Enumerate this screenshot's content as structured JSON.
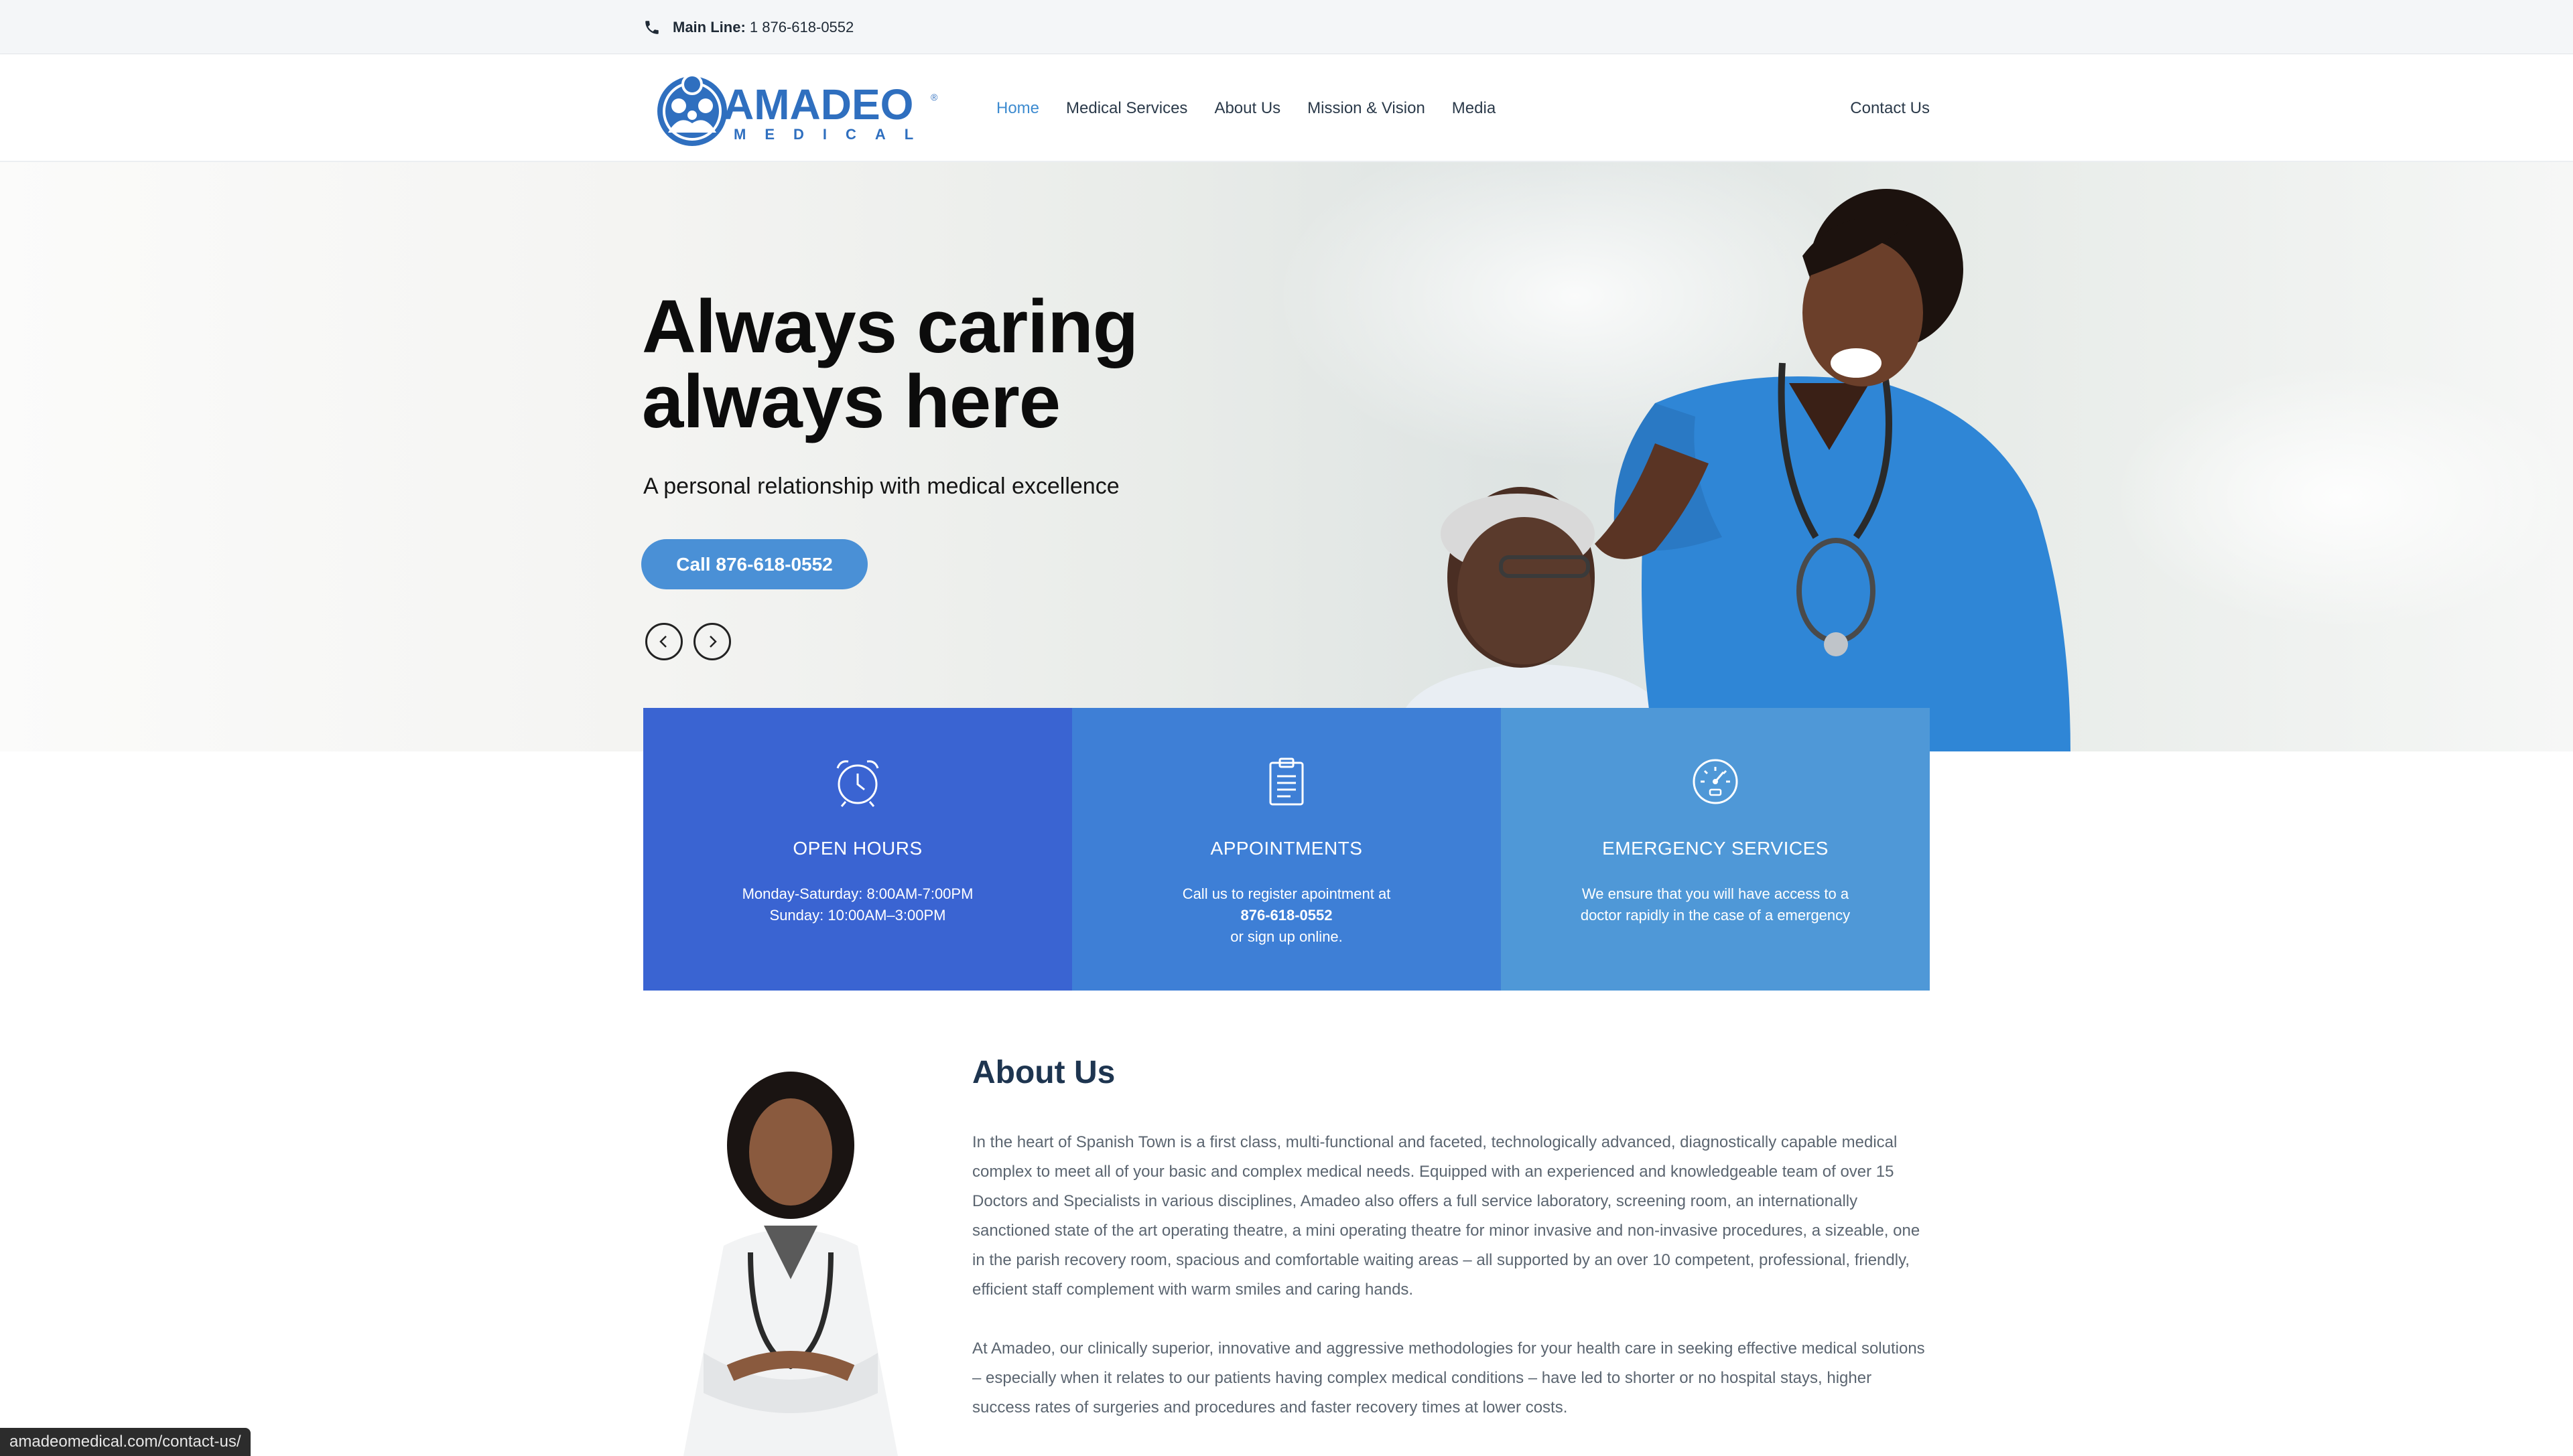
{
  "topbar": {
    "label": "Main Line:",
    "phone": "1 876-618-0552"
  },
  "brand": {
    "name": "AMADEO",
    "tagline": "MEDICAL",
    "reg": "®"
  },
  "nav": {
    "items": [
      {
        "label": "Home",
        "active": true
      },
      {
        "label": "Medical Services"
      },
      {
        "label": "About Us"
      },
      {
        "label": "Mission & Vision"
      },
      {
        "label": "Media"
      }
    ],
    "contact": "Contact Us"
  },
  "hero": {
    "title_line1": "Always caring",
    "title_line2": "always here",
    "subtitle": "A personal relationship with medical excellence",
    "cta": "Call 876-618-0552"
  },
  "features": [
    {
      "icon": "alarm-clock-icon",
      "title": "OPEN HOURS",
      "line1": "Monday-Saturday: 8:00AM-7:00PM",
      "line2": "Sunday: 10:00AM–3:00PM"
    },
    {
      "icon": "clipboard-icon",
      "title": "APPOINTMENTS",
      "line1": "Call us to register apointment at",
      "bold": "876-618-0552",
      "line2": "or sign up online."
    },
    {
      "icon": "gauge-icon",
      "title": "EMERGENCY SERVICES",
      "line1": "We ensure that you will have access to a",
      "line2": "doctor rapidly in the case of a emergency"
    }
  ],
  "about": {
    "title": "About Us",
    "p1": "In the heart of Spanish Town is a first class, multi-functional and faceted, technologically advanced, diagnostically capable  medical complex to meet all of your basic and complex medical needs. Equipped with an experienced and knowledgeable team of over 15 Doctors and Specialists in various disciplines, Amadeo also offers a full service laboratory, screening room, an internationally sanctioned state of the art operating theatre, a mini operating theatre for minor invasive and non-invasive procedures, a sizeable, one in the parish recovery room, spacious and comfortable waiting areas – all supported by an over 10 competent, professional, friendly, efficient staff complement with warm smiles and caring hands.",
    "p2": "At Amadeo, our clinically superior, innovative and aggressive methodologies for your health care in seeking effective medical solutions – especially when it relates to our patients having complex medical conditions – have led to shorter or no hospital stays, higher success rates of surgeries and procedures and faster recovery times at lower costs."
  },
  "status_url": "amadeomedical.com/contact-us/",
  "colors": {
    "accent": "#4a90d6",
    "box1": "#3a64d2",
    "box2": "#3e7fd6",
    "box3": "#4f98d7",
    "heading": "#1e3550"
  }
}
